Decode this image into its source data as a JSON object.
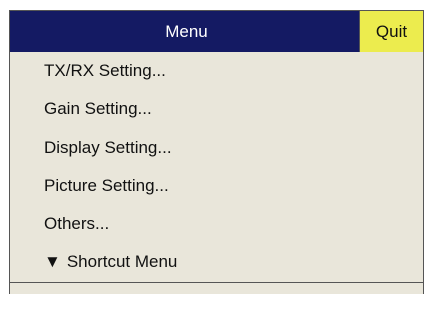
{
  "menu": {
    "title": "Menu",
    "quit_label": "Quit",
    "items": [
      {
        "label": "TX/RX Setting..."
      },
      {
        "label": "Gain Setting..."
      },
      {
        "label": "Display Setting..."
      },
      {
        "label": "Picture Setting..."
      },
      {
        "label": "Others..."
      },
      {
        "label": "Shortcut Menu",
        "icon_glyph": "▼",
        "icon": "triangle-down-icon"
      }
    ]
  },
  "colors": {
    "title_bar": "#141a63",
    "quit_button": "#ecec4e",
    "menu_background": "#e9e6da"
  }
}
